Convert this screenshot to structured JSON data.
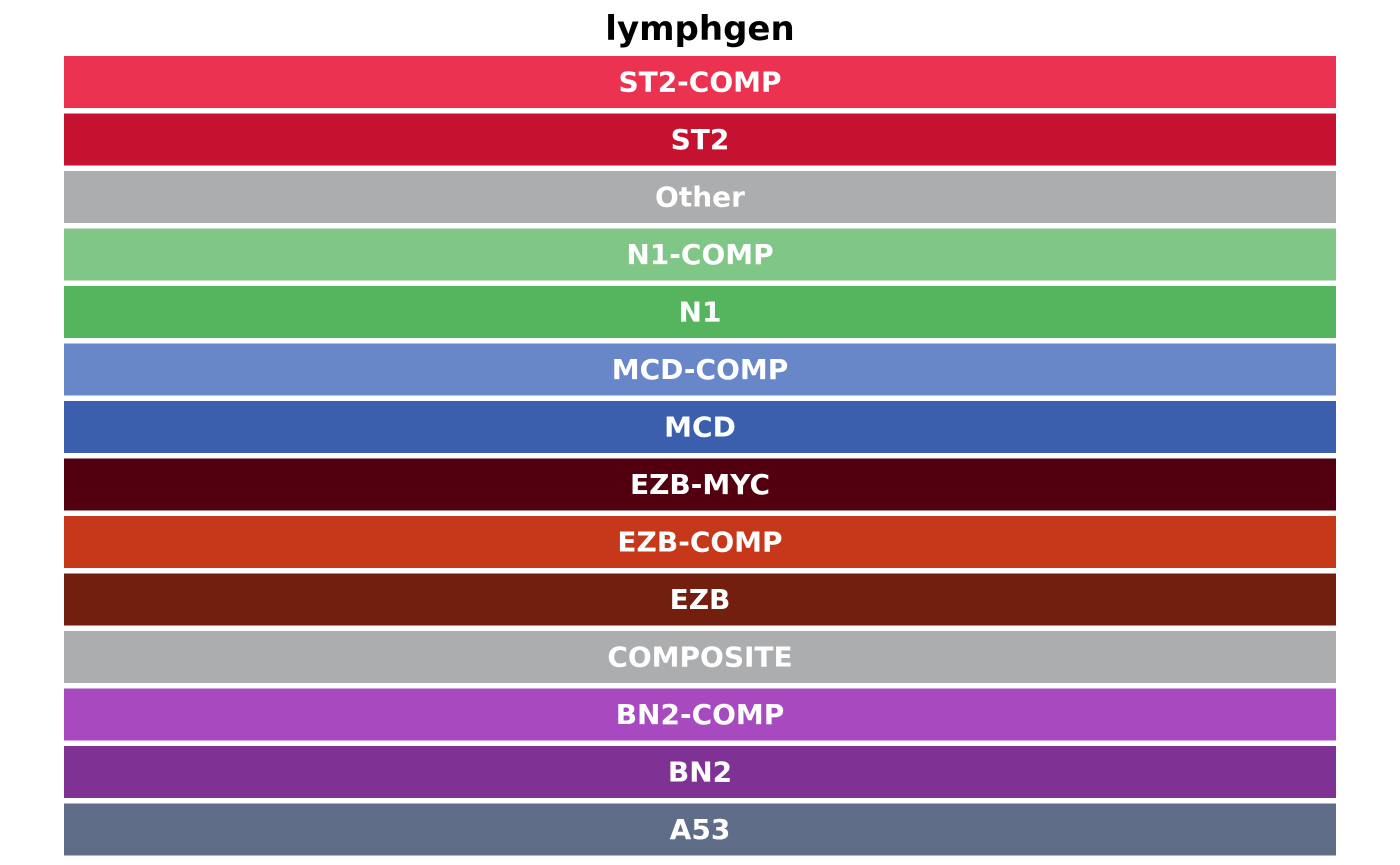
{
  "chart_data": {
    "type": "bar",
    "title": "lymphgen",
    "xlabel": "",
    "ylabel": "",
    "grid": false,
    "legend": "none",
    "categories": [
      "ST2-COMP",
      "ST2",
      "Other",
      "N1-COMP",
      "N1",
      "MCD-COMP",
      "MCD",
      "EZB-MYC",
      "EZB-COMP",
      "EZB",
      "COMPOSITE",
      "BN2-COMP",
      "BN2",
      "A53"
    ],
    "values": [
      1,
      1,
      1,
      1,
      1,
      1,
      1,
      1,
      1,
      1,
      1,
      1,
      1,
      1
    ],
    "colors": [
      "#EC3251",
      "#C41230",
      "#ACADAF",
      "#80C687",
      "#55B55E",
      "#6787C9",
      "#3B5FAC",
      "#52000F",
      "#C7371A",
      "#721F0F",
      "#ACADAF",
      "#A74AC0",
      "#7F3293",
      "#5F6D89"
    ],
    "label_color": "#FFFFFF"
  }
}
